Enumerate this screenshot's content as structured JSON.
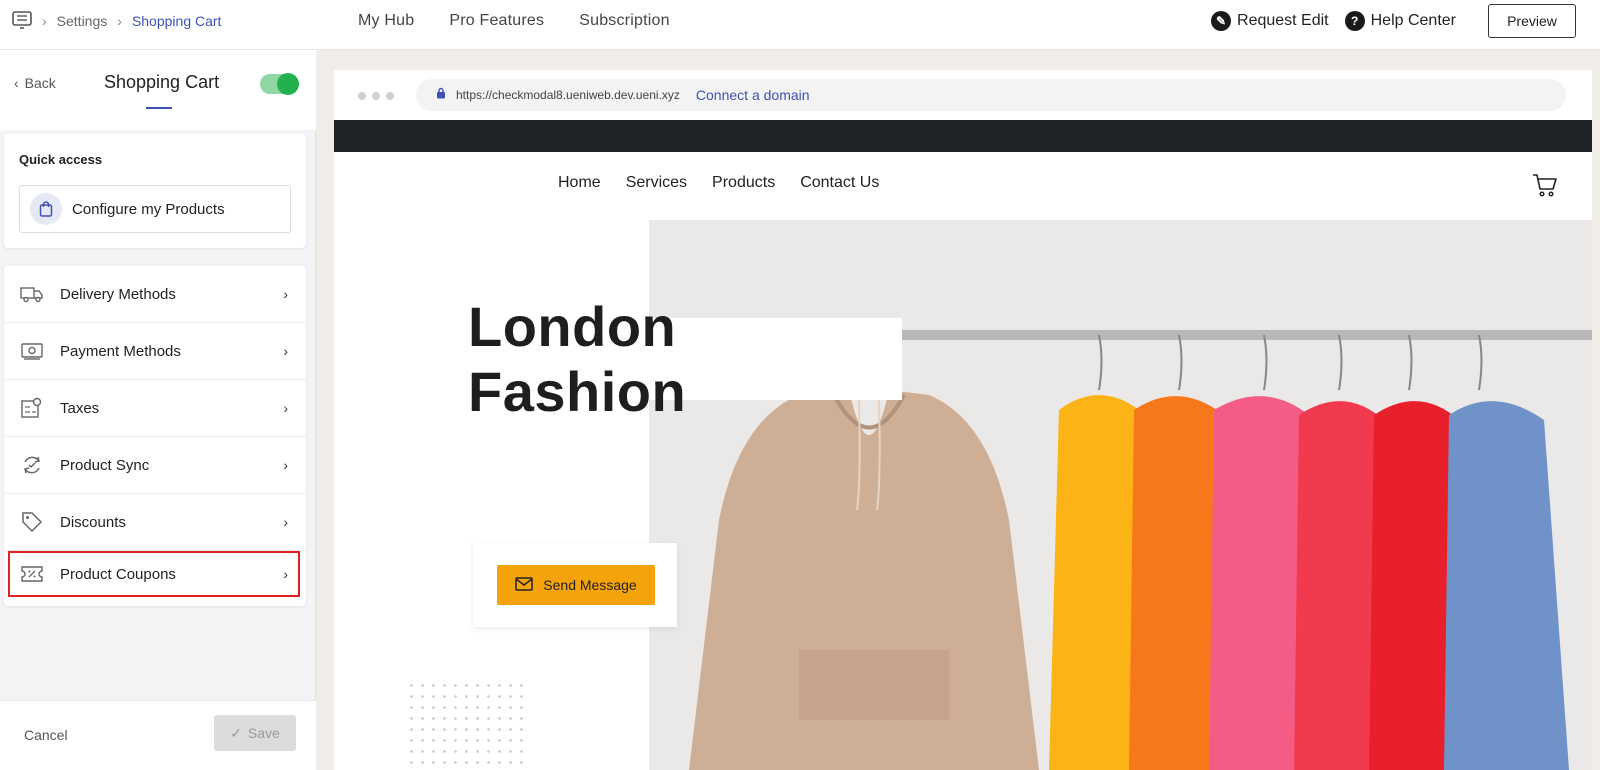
{
  "breadcrumb": {
    "settings": "Settings",
    "current": "Shopping Cart"
  },
  "topnav": {
    "items": [
      "My Hub",
      "Pro Features",
      "Subscription"
    ]
  },
  "topright": {
    "request_edit": "Request Edit",
    "help_center": "Help Center",
    "preview": "Preview"
  },
  "sidebar": {
    "back": "Back",
    "title": "Shopping Cart",
    "toggle_on": true,
    "quick_access": {
      "title": "Quick access",
      "button": "Configure my Products"
    },
    "items": [
      {
        "label": "Delivery Methods",
        "icon": "truck-icon"
      },
      {
        "label": "Payment Methods",
        "icon": "payment-icon"
      },
      {
        "label": "Taxes",
        "icon": "tax-icon"
      },
      {
        "label": "Product Sync",
        "icon": "sync-icon"
      },
      {
        "label": "Discounts",
        "icon": "tag-icon"
      },
      {
        "label": "Product Coupons",
        "icon": "coupon-icon"
      }
    ],
    "footer": {
      "cancel": "Cancel",
      "save": "Save"
    }
  },
  "preview": {
    "url": "https://checkmodal8.ueniweb.dev.ueni.xyz",
    "connect_domain": "Connect a domain",
    "site_nav": [
      "Home",
      "Services",
      "Products",
      "Contact Us"
    ],
    "hero_title": "London Fashion",
    "send_message": "Send Message"
  },
  "colors": {
    "accent": "#3f51b5",
    "toggle": "#22b14c",
    "cta": "#f5a30b",
    "highlight": "#e02020"
  }
}
